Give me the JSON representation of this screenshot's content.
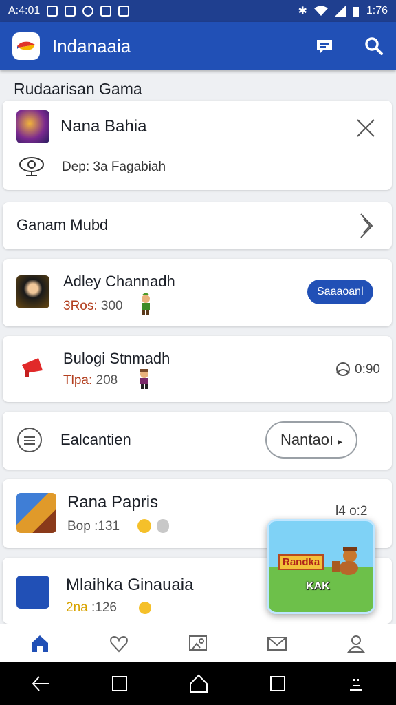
{
  "status_bar": {
    "time_left": "A:4:01",
    "time_right": "1:76"
  },
  "app_bar": {
    "title": "Indanaaia"
  },
  "section": {
    "title": "Rudaarisan Gama"
  },
  "featured": {
    "title": "Nana Bahia",
    "subtitle": "Dep: 3a Fagabiah"
  },
  "section_row": {
    "label": "Ganam Mubd"
  },
  "items": [
    {
      "title": "Adley Channadh",
      "sub_label": "3Ros:",
      "sub_value": "300",
      "action": "Saaaoanl"
    },
    {
      "title": "Bulogi Stnmadh",
      "sub_label": "Tlpa:",
      "sub_value": "208",
      "right_text": "0:90"
    }
  ],
  "menu_row": {
    "label": "Ealcantien",
    "button": "Nantaoı"
  },
  "list": [
    {
      "title": "Rana Papris",
      "sub_label": "Bop",
      "sub_value": ":131",
      "right_text": "l4 o:2"
    },
    {
      "title": "Mlaihka Ginauaia",
      "sub_label": "2na",
      "sub_value": ":126"
    }
  ],
  "floating_card": {
    "label": "Randka",
    "sub": "KAK"
  },
  "colors": {
    "primary": "#2150b6",
    "status_bar": "#1f3f8f",
    "background": "#eef0f3"
  }
}
